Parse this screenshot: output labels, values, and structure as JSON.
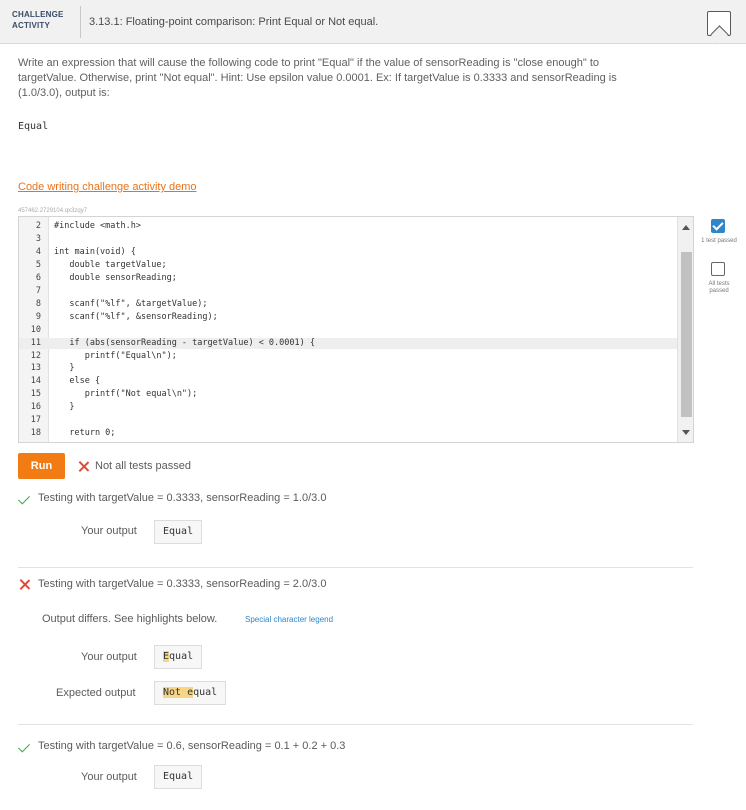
{
  "header": {
    "badge_line1": "CHALLENGE",
    "badge_line2": "ACTIVITY",
    "title": "3.13.1: Floating-point comparison: Print Equal or Not equal."
  },
  "description": "Write an expression that will cause the following code to print \"Equal\" if the value of sensorReading is \"close enough\" to targetValue. Otherwise, print \"Not equal\". Hint: Use epsilon value 0.0001. Ex: If targetValue is 0.3333 and sensorReading is (1.0/3.0), output is:",
  "example_output": "Equal",
  "demo_link": "Code writing challenge activity demo",
  "editor": {
    "id": "457462.2729104.qx3zqy7",
    "lines": [
      {
        "n": "2",
        "text": "#include <math.h>"
      },
      {
        "n": "3",
        "text": ""
      },
      {
        "n": "4",
        "text": "int main(void) {"
      },
      {
        "n": "5",
        "text": "   double targetValue;"
      },
      {
        "n": "6",
        "text": "   double sensorReading;"
      },
      {
        "n": "7",
        "text": ""
      },
      {
        "n": "8",
        "text": "   scanf(\"%lf\", &targetValue);"
      },
      {
        "n": "9",
        "text": "   scanf(\"%lf\", &sensorReading);"
      },
      {
        "n": "10",
        "text": ""
      },
      {
        "n": "11",
        "text": "   if (abs(sensorReading - targetValue) < 0.0001) {"
      },
      {
        "n": "12",
        "text": "      printf(\"Equal\\n\");"
      },
      {
        "n": "13",
        "text": "   }"
      },
      {
        "n": "14",
        "text": "   else {"
      },
      {
        "n": "15",
        "text": "      printf(\"Not equal\\n\");"
      },
      {
        "n": "16",
        "text": "   }"
      },
      {
        "n": "17",
        "text": ""
      },
      {
        "n": "18",
        "text": "   return 0;"
      }
    ]
  },
  "tests_panel": {
    "one_test_label": "1 test passed",
    "all_tests_label": "All tests passed"
  },
  "run": {
    "button_label": "Run",
    "status": "Not all tests passed"
  },
  "results": [
    {
      "title": "Testing with targetValue = 0.3333, sensorReading = 1.0/3.0",
      "passed": true,
      "your_output_label": "Your output",
      "your_output": "Equal"
    },
    {
      "title": "Testing with targetValue = 0.3333, sensorReading = 2.0/3.0",
      "passed": false,
      "differs_text": "Output differs. See highlights below.",
      "legend_link": "Special character legend",
      "your_output_label": "Your output",
      "your_output_hl": "E",
      "your_output_rest": "qual",
      "expected_output_label": "Expected output",
      "expected_a": "Not e",
      "expected_b": "qual"
    },
    {
      "title": "Testing with targetValue = 0.6, sensorReading = 0.1 + 0.2 + 0.3",
      "passed": true,
      "your_output_label": "Your output",
      "your_output": "Equal"
    }
  ]
}
